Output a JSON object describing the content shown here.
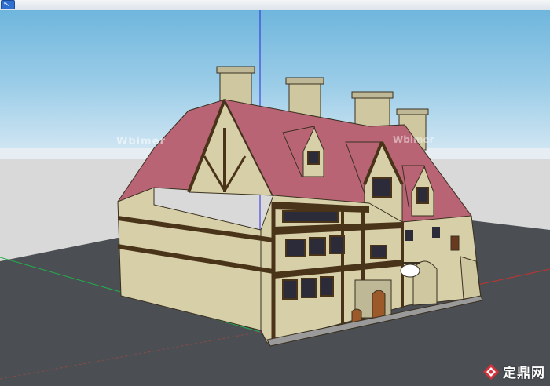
{
  "toolbar": {
    "tool_icon": "select-arrow-icon"
  },
  "viewport": {
    "watermark_center": "Wbimer",
    "watermark_right": "Wbimer",
    "brand_logo_text": "定鼎网",
    "colors": {
      "sky_top": "#6fb6dd",
      "ground": "#d9d9d9",
      "terrain": "#4b4f54",
      "roof": "#b86474",
      "stone": "#d6cfa8",
      "timber": "#4a3419",
      "axis_blue": "#2a2ad8",
      "axis_green": "#22b04a",
      "axis_red": "#c8322c"
    }
  }
}
